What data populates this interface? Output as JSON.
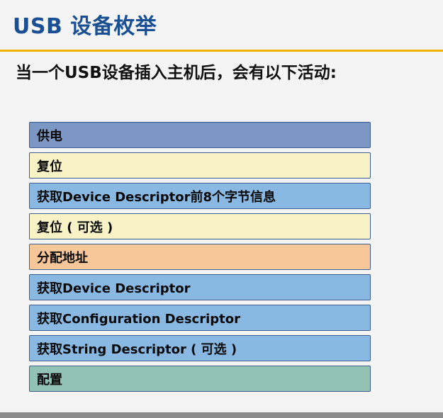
{
  "slide": {
    "title": "USB 设备枚举",
    "subtitle": "当一个USB设备插入主机后，会有以下活动:"
  },
  "steps": [
    {
      "label": "供电",
      "color": "#7c97c3"
    },
    {
      "label": "复位",
      "color": "#f7f3c6"
    },
    {
      "label": "获取Device Descriptor前8个字节信息",
      "color": "#89b8e3"
    },
    {
      "label": "复位 ( 可选 )",
      "color": "#f7f3c6"
    },
    {
      "label": "分配地址",
      "color": "#f7c79a"
    },
    {
      "label": "获取Device Descriptor",
      "color": "#89b8e3"
    },
    {
      "label": "获取Configuration Descriptor",
      "color": "#89b8e3"
    },
    {
      "label": "获取String Descriptor ( 可选 )",
      "color": "#89b8e3"
    },
    {
      "label": "配置",
      "color": "#92c2b4"
    }
  ],
  "colors": {
    "title": "#1a4f93",
    "accent_rule": "#f0b400",
    "background": "#f4f4f4",
    "bottom_bar": "#8a8a8a"
  }
}
